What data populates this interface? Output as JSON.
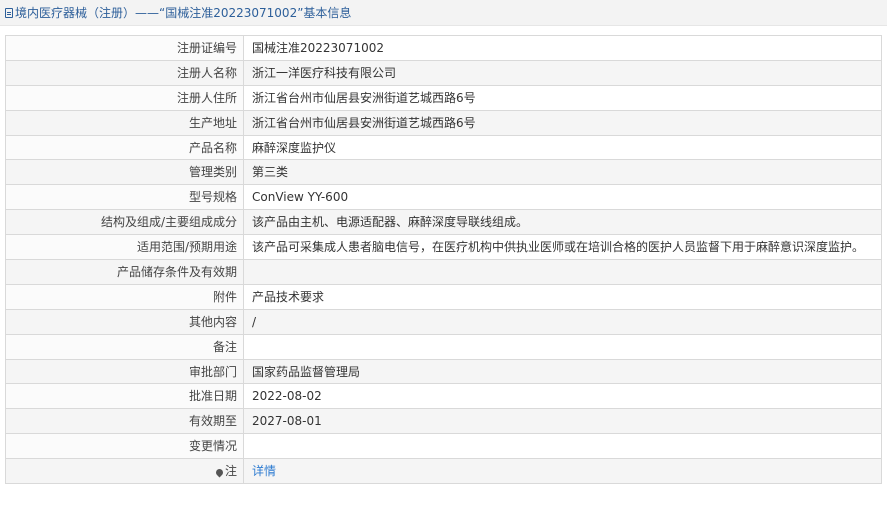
{
  "header": {
    "title": "境内医疗器械（注册）——“国械注准20223071002”基本信息"
  },
  "rows": [
    {
      "label": "注册证编号",
      "value": "国械注准20223071002"
    },
    {
      "label": "注册人名称",
      "value": "浙江一洋医疗科技有限公司"
    },
    {
      "label": "注册人住所",
      "value": "浙江省台州市仙居县安洲街道艺城西路6号"
    },
    {
      "label": "生产地址",
      "value": "浙江省台州市仙居县安洲街道艺城西路6号"
    },
    {
      "label": "产品名称",
      "value": "麻醉深度监护仪"
    },
    {
      "label": "管理类别",
      "value": "第三类"
    },
    {
      "label": "型号规格",
      "value": "ConView YY-600"
    },
    {
      "label": "结构及组成/主要组成成分",
      "value": "该产品由主机、电源适配器、麻醉深度导联线组成。"
    },
    {
      "label": "适用范围/预期用途",
      "value": "该产品可采集成人患者脑电信号，在医疗机构中供执业医师或在培训合格的医护人员监督下用于麻醉意识深度监护。"
    },
    {
      "label": "产品储存条件及有效期",
      "value": ""
    },
    {
      "label": "附件",
      "value": "产品技术要求"
    },
    {
      "label": "其他内容",
      "value": "/"
    },
    {
      "label": "备注",
      "value": ""
    },
    {
      "label": "审批部门",
      "value": "国家药品监督管理局"
    },
    {
      "label": "批准日期",
      "value": "2022-08-02"
    },
    {
      "label": "有效期至",
      "value": "2027-08-01"
    },
    {
      "label": "变更情况",
      "value": ""
    }
  ],
  "note_row": {
    "label": "注",
    "link_text": "详情"
  },
  "icons": {
    "header": "document-icon",
    "note": "pin-icon"
  },
  "colors": {
    "title": "#2d5f9a",
    "link": "#2d7bd1"
  }
}
